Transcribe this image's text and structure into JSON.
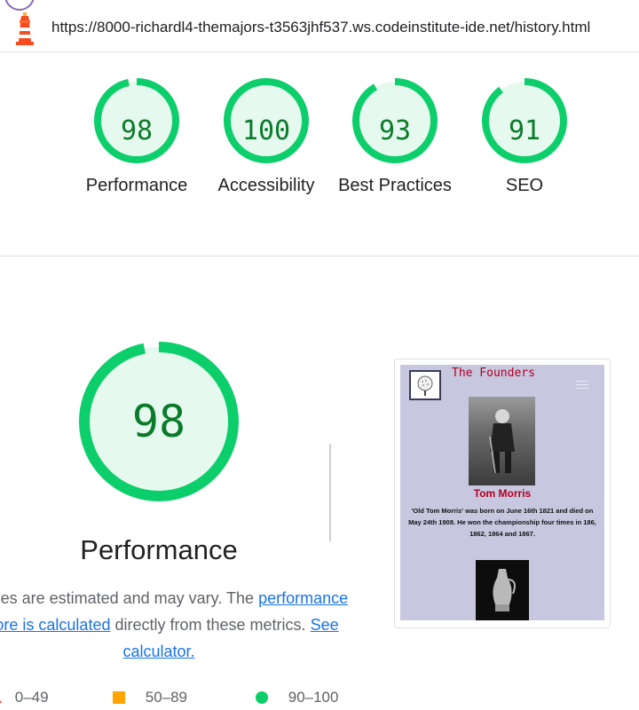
{
  "browser": {
    "url": "https://8000-richardl4-themajors-t3563jhf537.ws.codeinstitute-ide.net/history.html"
  },
  "summary_gauges": [
    {
      "score": "98",
      "label": "Performance",
      "fraction": 0.98
    },
    {
      "score": "100",
      "label": "Accessibility",
      "fraction": 1.0
    },
    {
      "score": "93",
      "label": "Best Practices",
      "fraction": 0.93
    },
    {
      "score": "91",
      "label": "SEO",
      "fraction": 0.91
    }
  ],
  "performance": {
    "score": "98",
    "fraction": 0.98,
    "title": "Performance",
    "desc_part1": "Values are estimated and may vary. The",
    "desc_link1": "performance score is calculated",
    "desc_part2": "directly from these metrics.",
    "desc_link2": "See calculator."
  },
  "legend": {
    "fail": "0–49",
    "average": "50–89",
    "pass": "90–100"
  },
  "screenshot": {
    "brand": "The Founders",
    "name": "Tom Morris",
    "bio": "'Old Tom Morris' was born on June 16th 1821 and died on May 24th 1908. He won the championship four times in 186, 1862, 1864 and 1867."
  },
  "colors": {
    "pass": "#0cce6b",
    "pass_fill": "#e6f9ee",
    "pass_text": "#0b7a2b",
    "average": "#ffa400",
    "link": "#1a73e8"
  }
}
